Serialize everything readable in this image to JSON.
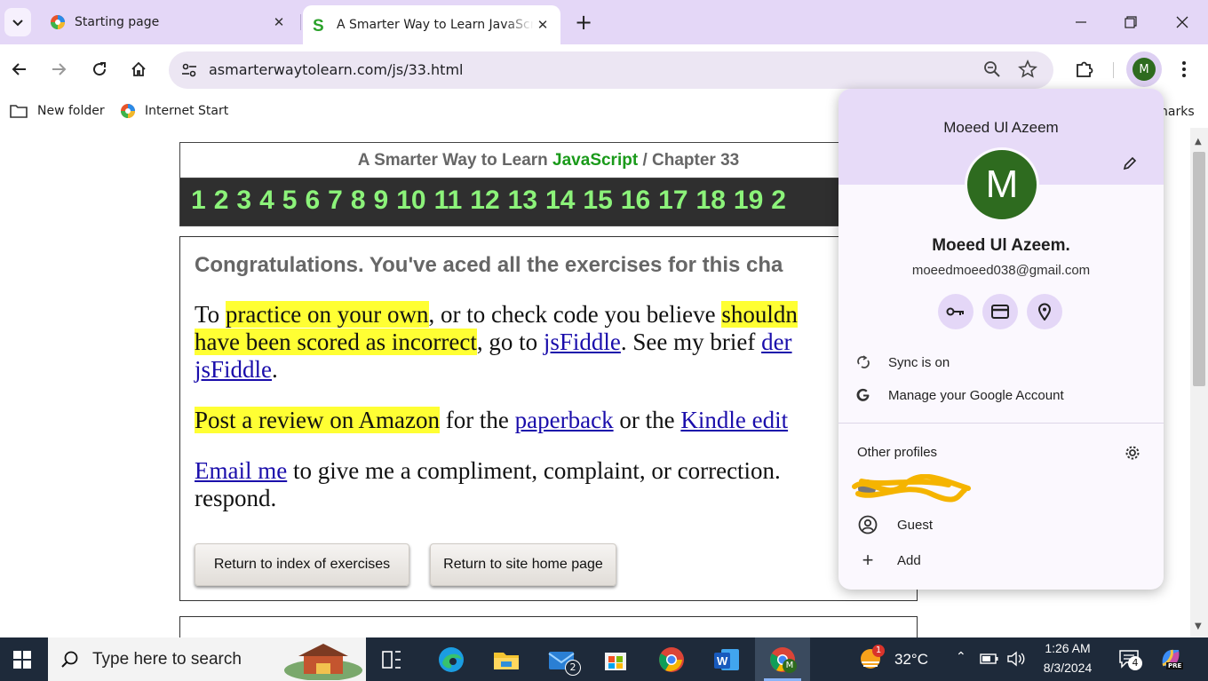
{
  "browser": {
    "tabs": [
      {
        "title": "Starting page",
        "active": false
      },
      {
        "title": "A Smarter Way to Learn JavaScript",
        "active": true
      }
    ],
    "url": "asmarterwaytolearn.com/js/33.html",
    "bookmarks": [
      {
        "label": "New folder",
        "icon": "folder-icon"
      },
      {
        "label": "Internet Start",
        "icon": "internet-start-icon"
      }
    ],
    "bookmarks_overflow": "narks",
    "avatar_letter": "M"
  },
  "page": {
    "header_prefix": "A Smarter Way to Learn",
    "header_js": "JavaScript",
    "header_sep": "/",
    "header_chapter": "Chapter 33",
    "chapter_numbers": [
      "1",
      "2",
      "3",
      "4",
      "5",
      "6",
      "7",
      "8",
      "9",
      "10",
      "11",
      "12",
      "13",
      "14",
      "15",
      "16",
      "17",
      "18",
      "19",
      "2"
    ],
    "congrats": "Congratulations. You've aced all the exercises for this cha",
    "p1": {
      "t1": "To ",
      "hl1": "practice on your own",
      "t2": ", or to check code you believe ",
      "hl2a": "shouldn",
      "hl2b": "have been scored as incorrect",
      "t3": ", go to ",
      "link1": "jsFiddle",
      "t4": ". See my brief ",
      "link2": "der",
      "link3": "jsFiddle",
      "t5": "."
    },
    "p2": {
      "hl": "Post a review on Amazon",
      "t1": " for the ",
      "link1": "paperback",
      "t2": " or the ",
      "link2": "Kindle edit"
    },
    "p3": {
      "link": "Email me",
      "t1": " to give me a compliment, complaint, or correction.",
      "t2": "respond."
    },
    "buttons": {
      "index": "Return to index of exercises",
      "home": "Return to site home page"
    }
  },
  "profile_panel": {
    "title_name": "Moeed Ul Azeem",
    "avatar_letter": "M",
    "full_name": "Moeed Ul Azeem.",
    "email": "moeedmoeed038@gmail.com",
    "quick_icons": [
      "key-icon",
      "card-icon",
      "location-pin-icon"
    ],
    "sync": "Sync is on",
    "manage": "Manage your Google Account",
    "other_profiles": "Other profiles",
    "guest": "Guest",
    "add": "Add"
  },
  "taskbar": {
    "search_placeholder": "Type here to search",
    "mail_badge": "2",
    "weather_badge": "1",
    "temperature": "32°C",
    "time": "1:26 AM",
    "date": "8/3/2024",
    "notification_count": "4",
    "copilot_badge": "PRE",
    "chrome_profile_letter": "M"
  }
}
